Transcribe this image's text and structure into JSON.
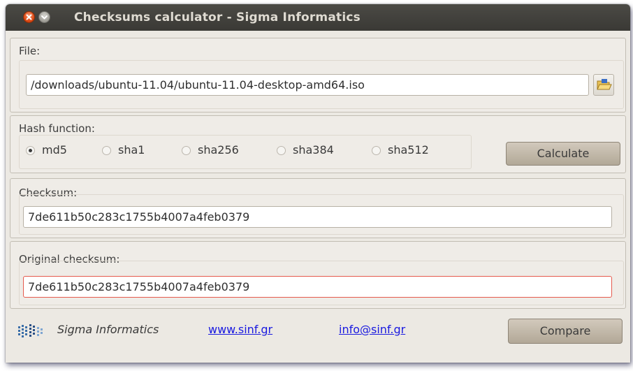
{
  "window": {
    "title": "Checksums calculator - Sigma Informatics"
  },
  "file": {
    "label": "File:",
    "path": "/downloads/ubuntu-11.04/ubuntu-11.04-desktop-amd64.iso",
    "browse_icon": "open-folder-icon"
  },
  "hash": {
    "label": "Hash function:",
    "options": [
      "md5",
      "sha1",
      "sha256",
      "sha384",
      "sha512"
    ],
    "selected": "md5",
    "calculate_label": "Calculate"
  },
  "checksum": {
    "label": "Checksum:",
    "value": "7de611b50c283c1755b4007a4feb0379"
  },
  "original": {
    "label": "Original checksum:",
    "value": "7de611b50c283c1755b4007a4feb0379",
    "border_color": "#e55a4d"
  },
  "footer": {
    "company": "Sigma Informatics",
    "website": "www.sinf.gr",
    "email": "info@sinf.gr",
    "compare_label": "Compare",
    "logo_icon": "sigma-logo-icon"
  }
}
